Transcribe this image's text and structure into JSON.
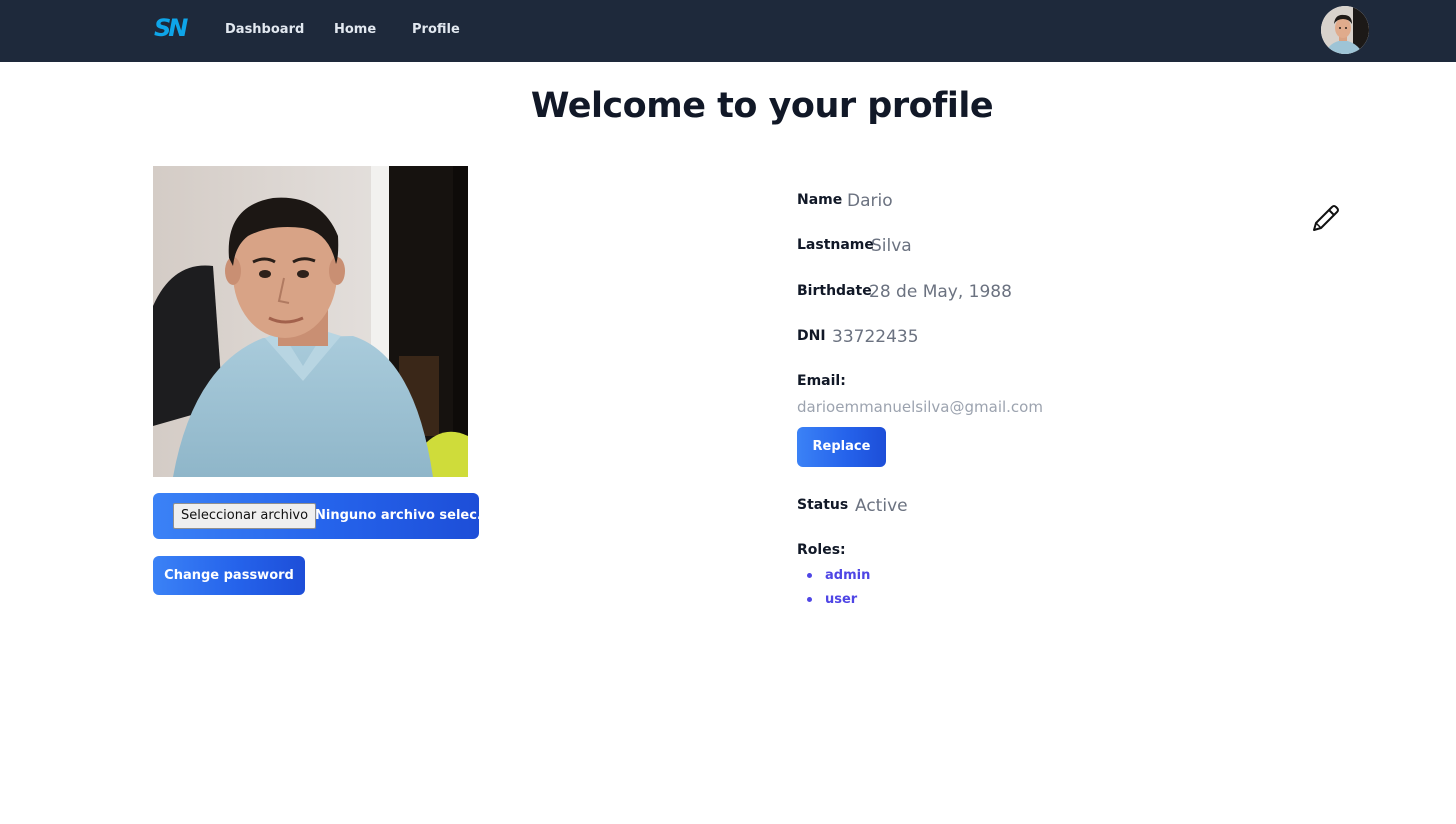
{
  "navbar": {
    "logo": "SN",
    "links": [
      {
        "label": "Dashboard"
      },
      {
        "label": "Home"
      },
      {
        "label": "Profile"
      }
    ],
    "avatar_icon": "user-avatar"
  },
  "page": {
    "title": "Welcome to your profile"
  },
  "upload": {
    "button_label": "Seleccionar archivo",
    "status": "Ninguno archivo selec."
  },
  "actions": {
    "change_password": "Change password",
    "replace": "Replace"
  },
  "profile": {
    "name_label": "Name",
    "name": "Dario",
    "lastname_label": "Lastname",
    "lastname": "Silva",
    "birthdate_label": "Birthdate",
    "birthdate": "28 de May, 1988",
    "dni_label": "DNI",
    "dni": "33722435",
    "email_label": "Email:",
    "email": "darioemmanuelsilva@gmail.com",
    "status_label": "Status",
    "status": "Active",
    "roles_label": "Roles:",
    "roles": [
      "admin",
      "user"
    ]
  },
  "colors": {
    "navbar_bg": "#1e293b",
    "logo": "#0ea5e9",
    "button_gradient_start": "#3b82f6",
    "button_gradient_end": "#1d4ed8",
    "role_text": "#4f46e5"
  },
  "icons": {
    "edit": "pencil-icon"
  }
}
